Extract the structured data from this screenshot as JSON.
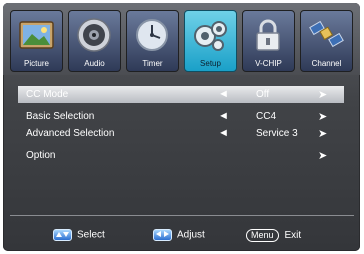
{
  "tabs": [
    {
      "label": "Picture",
      "icon": "picture-icon",
      "active": false
    },
    {
      "label": "Audio",
      "icon": "speaker-icon",
      "active": false
    },
    {
      "label": "Timer",
      "icon": "clock-icon",
      "active": false
    },
    {
      "label": "Setup",
      "icon": "gears-icon",
      "active": true
    },
    {
      "label": "V-CHIP",
      "icon": "lock-icon",
      "active": false
    },
    {
      "label": "Channel",
      "icon": "satellite-icon",
      "active": false
    }
  ],
  "menu": {
    "items": [
      {
        "label": "CC Mode",
        "value": "Off",
        "left_arrow": "◄",
        "right_arrow": "➤",
        "selected": true
      },
      {
        "label": "Basic Selection",
        "value": "CC4",
        "left_arrow": "◄",
        "right_arrow": "➤",
        "selected": false
      },
      {
        "label": "Advanced Selection",
        "value": "Service 3",
        "left_arrow": "◄",
        "right_arrow": "➤",
        "selected": false
      },
      {
        "label": "Option",
        "value": "",
        "left_arrow": "",
        "right_arrow": "➤",
        "selected": false
      }
    ]
  },
  "footer": {
    "select_label": "Select",
    "adjust_label": "Adjust",
    "menu_key": "Menu",
    "exit_label": "Exit"
  },
  "colors": {
    "active_tab": "#1aa0c8",
    "selected_row": "#d5d7db",
    "panel_background": "#414347"
  }
}
